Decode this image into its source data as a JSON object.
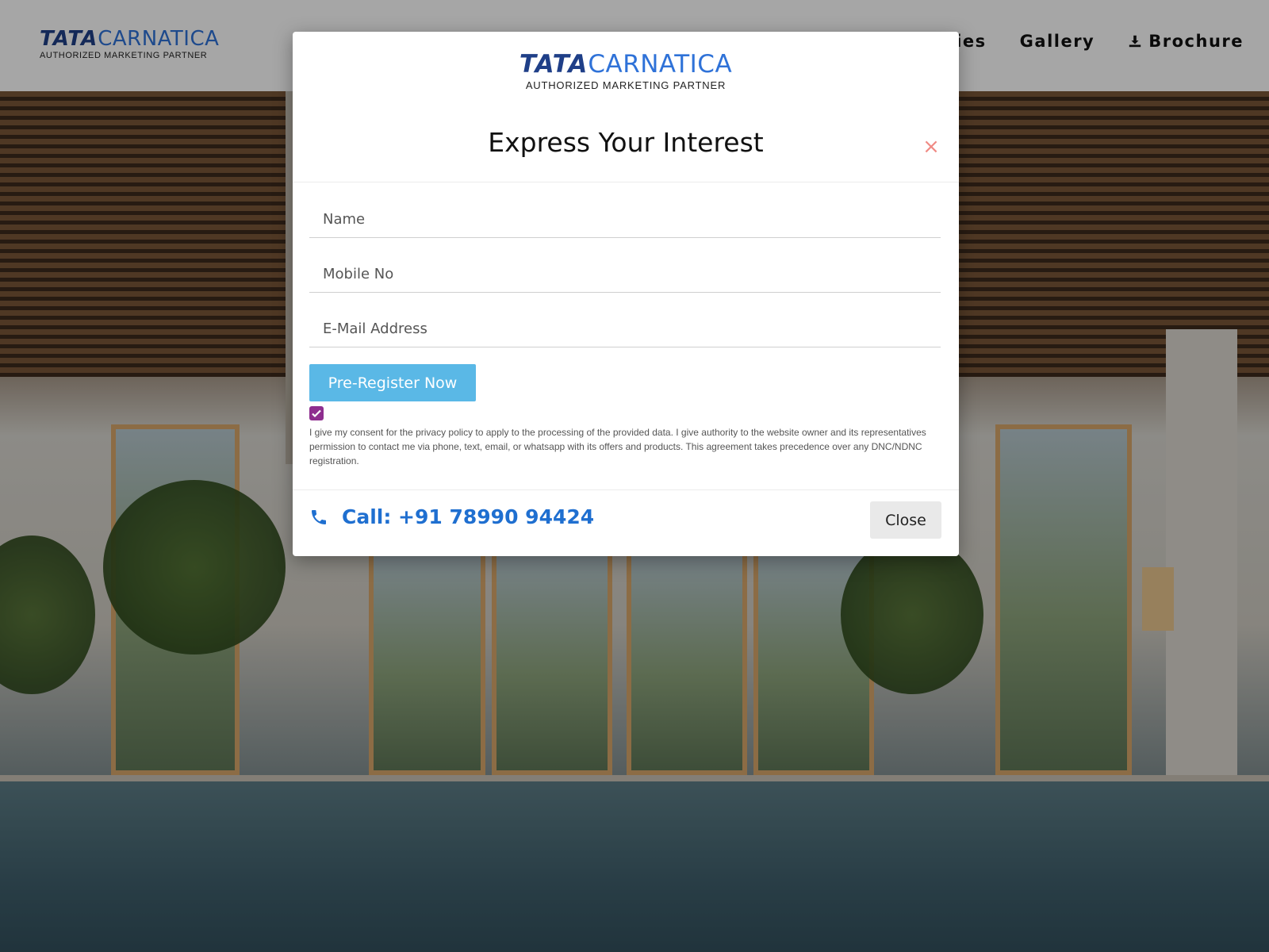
{
  "site": {
    "logo": {
      "brand_bold": "TATA",
      "brand_name": "CARNATICA",
      "tagline": "AUTHORIZED MARKETING PARTNER"
    },
    "nav": [
      {
        "label": "ties"
      },
      {
        "label": "Gallery"
      },
      {
        "label": "Brochure",
        "icon": "download-icon"
      }
    ]
  },
  "modal": {
    "logo": {
      "brand_bold": "TATA",
      "brand_name": "CARNATICA",
      "tagline": "AUTHORIZED MARKETING PARTNER"
    },
    "title": "Express Your Interest",
    "close_symbol": "×",
    "fields": {
      "name_placeholder": "Name",
      "mobile_placeholder": "Mobile No",
      "email_placeholder": "E-Mail Address"
    },
    "submit_label": "Pre-Register Now",
    "consent": {
      "checked": true,
      "text": "I give my consent for the privacy policy to apply to the processing of the provided data. I give authority to the website owner and its representatives permission to contact me via phone, text, email, or whatsapp with its offers and products. This agreement takes precedence over any DNC/NDNC registration."
    },
    "footer": {
      "call_text": "Call: +91 78990 94424",
      "close_label": "Close"
    }
  },
  "colors": {
    "brand_dark": "#1f3f88",
    "brand_light": "#2f72d8",
    "submit_button": "#5ab8e6",
    "close_x": "#f08a84",
    "call_text": "#1f6fd0",
    "checkbox": "#8e2e8f"
  }
}
